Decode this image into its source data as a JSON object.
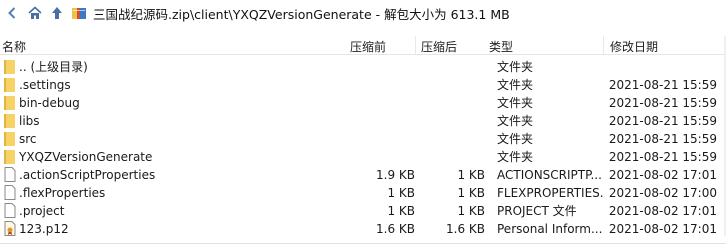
{
  "title_path": "三国战纪源码.zip\\client\\YXQZVersionGenerate - 解包大小为 613.1 MB",
  "columns": {
    "name": "名称",
    "compressed": "压缩前",
    "size": "压缩后",
    "type": "类型",
    "modified": "修改日期"
  },
  "rows": [
    {
      "name": ".. (上级目录)",
      "compressed": "",
      "size": "",
      "type": "文件夹",
      "modified": "",
      "icon": "folder-icon"
    },
    {
      "name": ".settings",
      "compressed": "",
      "size": "",
      "type": "文件夹",
      "modified": "2021-08-21 15:59",
      "icon": "folder-icon"
    },
    {
      "name": "bin-debug",
      "compressed": "",
      "size": "",
      "type": "文件夹",
      "modified": "2021-08-21 15:59",
      "icon": "folder-icon"
    },
    {
      "name": "libs",
      "compressed": "",
      "size": "",
      "type": "文件夹",
      "modified": "2021-08-21 15:59",
      "icon": "folder-icon"
    },
    {
      "name": "src",
      "compressed": "",
      "size": "",
      "type": "文件夹",
      "modified": "2021-08-21 15:59",
      "icon": "folder-icon"
    },
    {
      "name": "YXQZVersionGenerate",
      "compressed": "",
      "size": "",
      "type": "文件夹",
      "modified": "2021-08-21 15:59",
      "icon": "folder-icon"
    },
    {
      "name": ".actionScriptProperties",
      "compressed": "1.9 KB",
      "size": "1 KB",
      "type": "ACTIONSCRIPTP...",
      "modified": "2021-08-02 17:01",
      "icon": "file-icon"
    },
    {
      "name": ".flexProperties",
      "compressed": "1 KB",
      "size": "1 KB",
      "type": "FLEXPROPERTIES...",
      "modified": "2021-08-02 17:00",
      "icon": "file-icon"
    },
    {
      "name": ".project",
      "compressed": "1 KB",
      "size": "1 KB",
      "type": "PROJECT 文件",
      "modified": "2021-08-02 17:01",
      "icon": "file-icon"
    },
    {
      "name": "123.p12",
      "compressed": "1.6 KB",
      "size": "1.6 KB",
      "type": "Personal Inform...",
      "modified": "2021-08-02 17:01",
      "icon": "certificate-icon"
    }
  ],
  "colors": {
    "folder": "#f7d266",
    "folder_dark": "#e1b43d",
    "nav_icon": "#4a6fa5"
  }
}
